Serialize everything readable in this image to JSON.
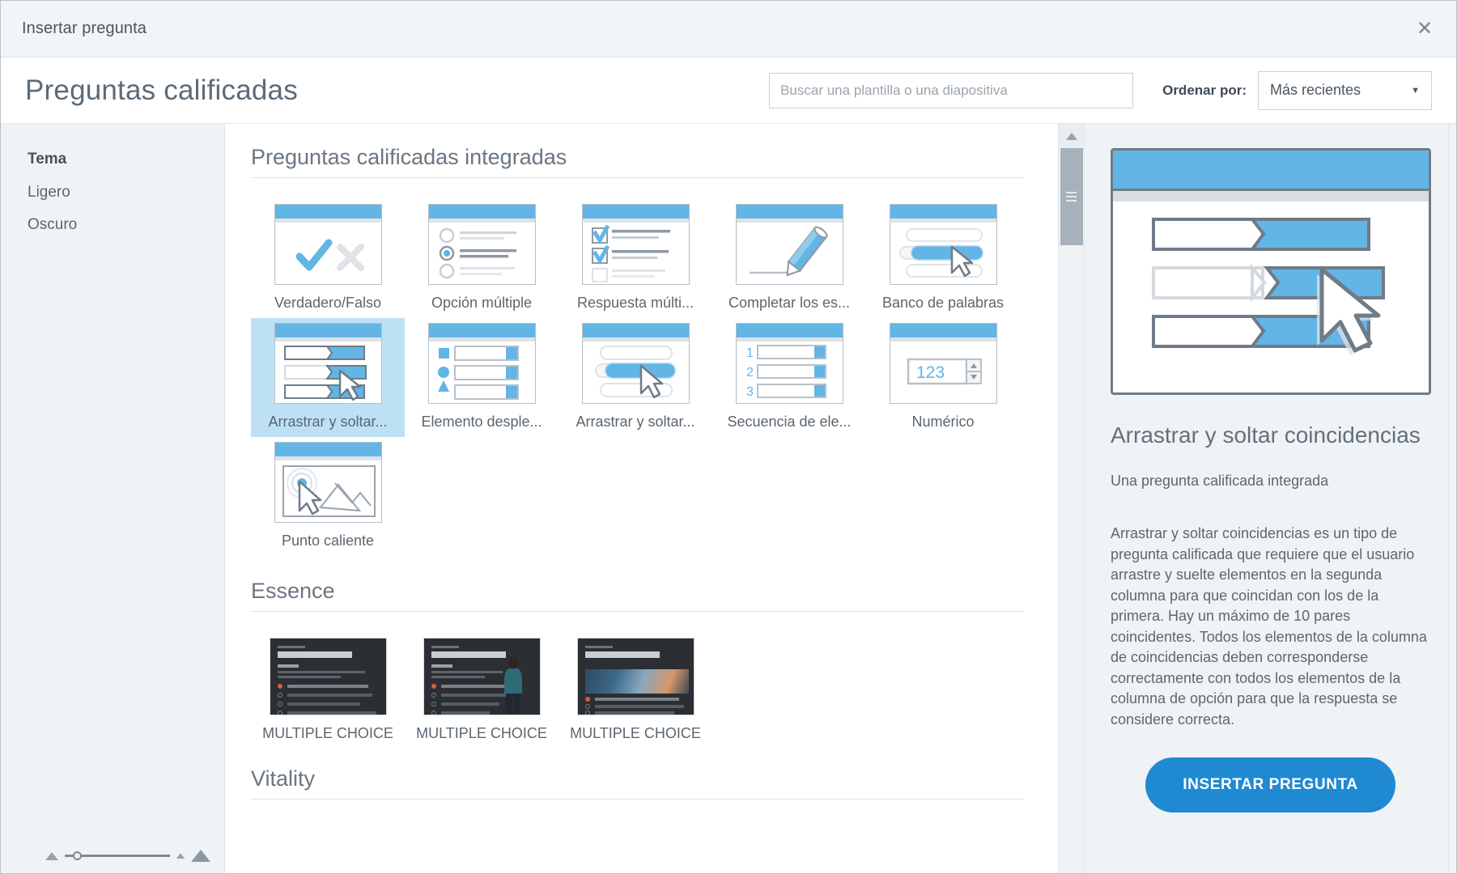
{
  "window": {
    "title": "Insertar pregunta",
    "close_icon": "close-icon"
  },
  "header": {
    "page_title": "Preguntas calificadas",
    "search": {
      "value": "",
      "placeholder": "Buscar una plantilla o una diapositiva"
    },
    "sort": {
      "label": "Ordenar por:",
      "selected": "Más recientes",
      "caret_icon": "chevron-down-icon"
    }
  },
  "sidebar": {
    "heading": "Tema",
    "items": [
      {
        "label": "Ligero"
      },
      {
        "label": "Oscuro"
      }
    ]
  },
  "gallery": {
    "sections": [
      {
        "title": "Preguntas calificadas integradas",
        "tiles": [
          {
            "label": "Verdadero/Falso",
            "icon": "true-false-icon",
            "selected": false
          },
          {
            "label": "Opción múltiple",
            "icon": "radio-list-icon",
            "selected": false
          },
          {
            "label": "Respuesta múlti...",
            "icon": "checkbox-list-icon",
            "selected": false
          },
          {
            "label": "Completar los es...",
            "icon": "pencil-icon",
            "selected": false
          },
          {
            "label": "Banco de palabras",
            "icon": "word-bank-icon",
            "selected": false
          },
          {
            "label": "Arrastrar y soltar...",
            "icon": "drag-drop-matching-icon",
            "selected": true
          },
          {
            "label": "Elemento desple...",
            "icon": "dropdown-item-icon",
            "selected": false
          },
          {
            "label": "Arrastrar y soltar...",
            "icon": "drag-drop-icon",
            "selected": false
          },
          {
            "label": "Secuencia de ele...",
            "icon": "sequence-icon",
            "selected": false
          },
          {
            "label": "Numérico",
            "icon": "numeric-icon",
            "numeric_value": "123",
            "selected": false
          },
          {
            "label": "Punto caliente",
            "icon": "hotspot-icon",
            "selected": false
          }
        ]
      },
      {
        "title": "Essence",
        "tiles": [
          {
            "label": "MULTIPLE CHOICE",
            "icon": "slide-thumbnail",
            "variant": "text"
          },
          {
            "label": "MULTIPLE CHOICE",
            "icon": "slide-thumbnail",
            "variant": "person"
          },
          {
            "label": "MULTIPLE CHOICE",
            "icon": "slide-thumbnail",
            "variant": "image"
          }
        ]
      },
      {
        "title": "Vitality",
        "tiles": []
      }
    ],
    "sequence_numbers": [
      "1",
      "2",
      "3"
    ],
    "scrollbar": {
      "up_icon": "scroll-up-arrow-icon",
      "grip_icon": "scrollbar-grip-icon"
    }
  },
  "preview": {
    "thumbnail_icon": "drag-drop-matching-preview",
    "title": "Arrastrar y soltar coincidencias",
    "subtitle": "Una pregunta calificada integrada",
    "description": "Arrastrar y soltar coincidencias es un tipo de pregunta calificada que requiere que el usuario arrastre y suelte elementos en la segunda columna para que coincidan con los de la primera. Hay un máximo de 10 pares coincidentes. Todos los elementos de la columna de coincidencias deben corresponderse correctamente con todos los elementos de la columna de opción para que la respuesta se considere correcta.",
    "insert_button": "INSERTAR PREGUNTA"
  },
  "zoom_widget": {
    "decrease_icon": "zoom-out-icon",
    "increase_icon": "zoom-in-icon"
  },
  "colors": {
    "accent": "#62b5e5",
    "button": "#1f8ad2",
    "selection": "#bde0f5",
    "panel": "#eff3f6",
    "text": "#5c6772"
  }
}
